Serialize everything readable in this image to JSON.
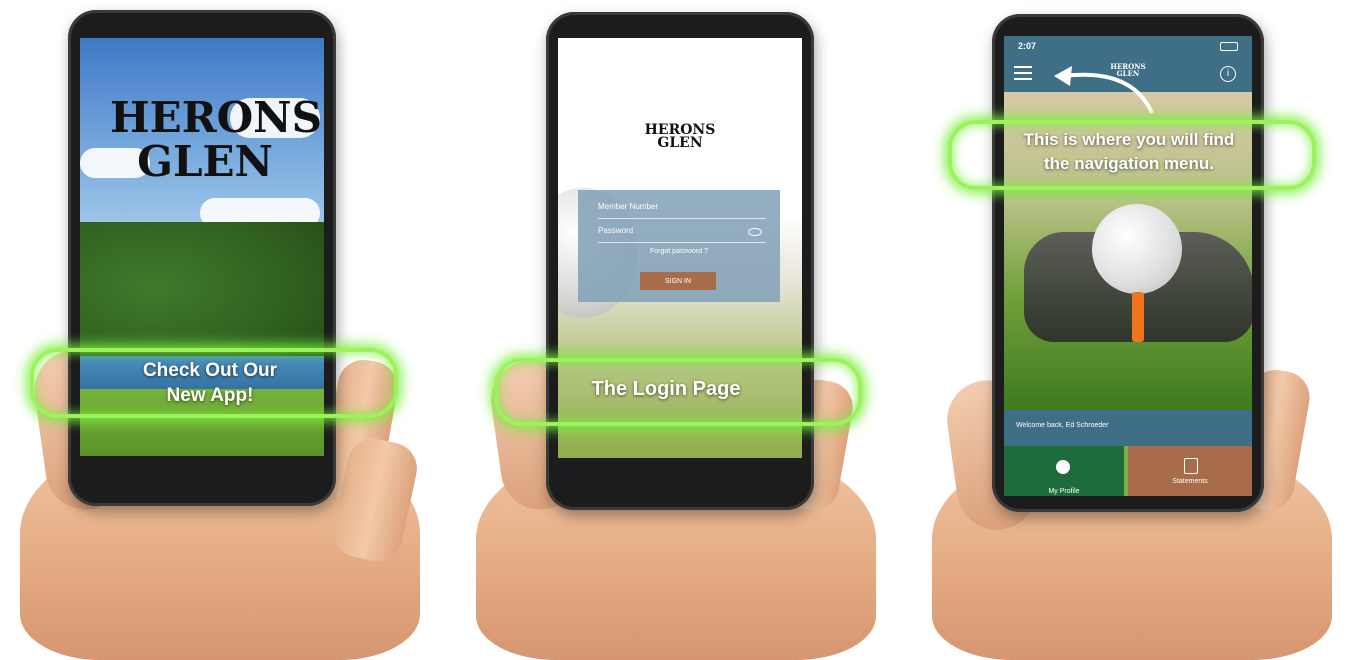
{
  "panel1": {
    "logo_line1": "HERONS",
    "logo_line2": "GLEN",
    "caption_line1": "Check Out Our",
    "caption_line2": "New App!"
  },
  "panel2": {
    "logo_line1": "HERONS",
    "logo_line2": "GLEN",
    "member_placeholder": "Member Number",
    "password_placeholder": "Password",
    "forgot_link": "Forgot password ?",
    "signin_label": "SIGN IN",
    "caption": "The Login Page"
  },
  "panel3": {
    "status_time": "2:07",
    "logo_line1": "HERONS",
    "logo_line2": "GLEN",
    "caption_line1": "This is where you will find",
    "caption_line2": "the navigation menu.",
    "welcome_text": "Welcome back, Ed Schroeder",
    "tile_profile": "My Profile",
    "tile_statements": "Statements"
  },
  "colors": {
    "glow": "#9cf25a",
    "topbar": "#3f6f86",
    "profile_tile": "#1e6b3c",
    "statements_tile": "#a86c4b",
    "signin_button": "#a86c4b",
    "login_box": "#80a0b6"
  },
  "icons": {
    "menu": "hamburger-menu-icon",
    "info": "info-icon",
    "profile": "person-icon",
    "statements": "clipboard-icon",
    "password_toggle": "eye-icon",
    "arrow": "curved-arrow-icon"
  }
}
